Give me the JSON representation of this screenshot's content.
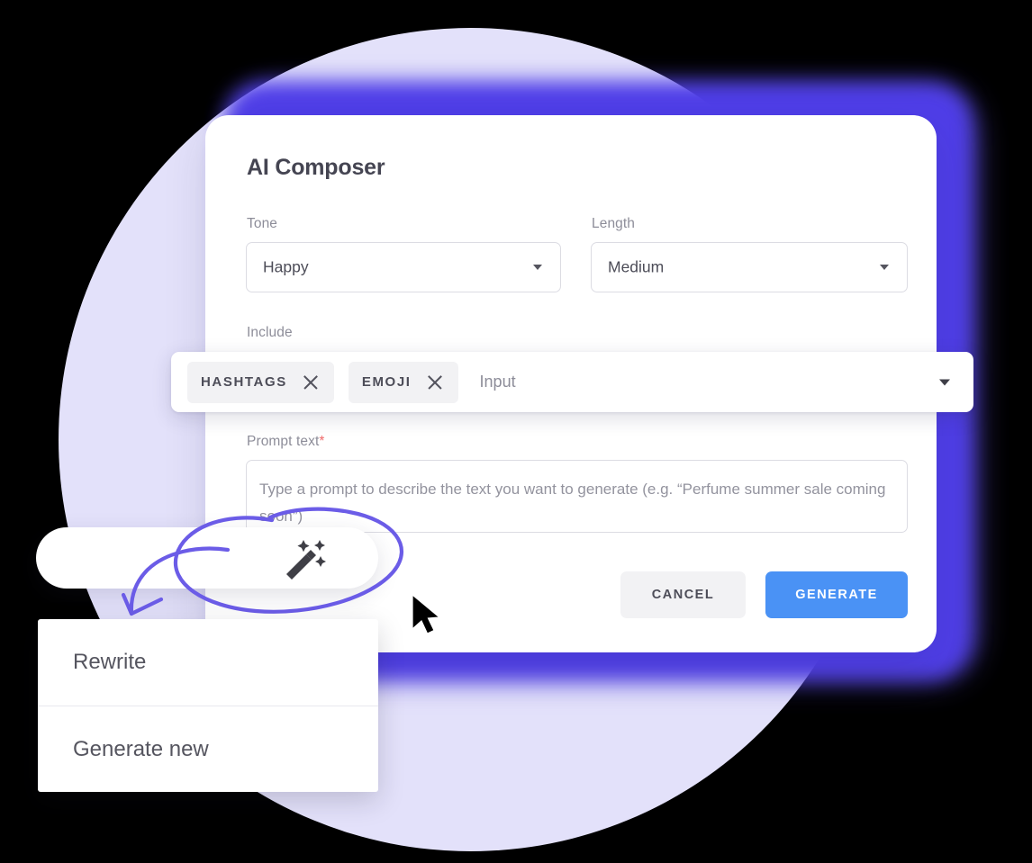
{
  "card": {
    "title": "AI Composer",
    "fields": {
      "tone": {
        "label": "Tone",
        "value": "Happy",
        "caret_icon": "chevron-down-icon"
      },
      "length": {
        "label": "Length",
        "value": "Medium",
        "caret_icon": "chevron-down-icon"
      },
      "include": {
        "label": "Include"
      },
      "prompt": {
        "label": "Prompt text",
        "required_mark": "*",
        "placeholder": "Type a prompt to describe the text you want to generate (e.g. “Perfume summer sale coming soon”)"
      }
    },
    "tag_input": {
      "chips": [
        {
          "label": "HASHTAGS",
          "remove_icon": "close-icon"
        },
        {
          "label": "EMOJI",
          "remove_icon": "close-icon"
        }
      ],
      "placeholder": "Input",
      "caret_icon": "chevron-down-icon"
    },
    "actions": {
      "cancel_label": "CANCEL",
      "generate_label": "GENERATE"
    }
  },
  "toolbar": {
    "wand_icon": "magic-wand-icon"
  },
  "menu": {
    "items": [
      {
        "label": "Rewrite"
      },
      {
        "label": "Generate new"
      }
    ]
  },
  "annotations": {
    "circle_icon": "hand-drawn-ellipse",
    "arrow_icon": "hand-drawn-arrow",
    "cursor_icon": "mouse-pointer-icon"
  },
  "colors": {
    "background": "#000000",
    "blob": "#e3e1fa",
    "glow": "#4f3ee8",
    "primary_button": "#4a92f5",
    "annotation": "#6b5ce7",
    "required": "#f06b6b"
  }
}
